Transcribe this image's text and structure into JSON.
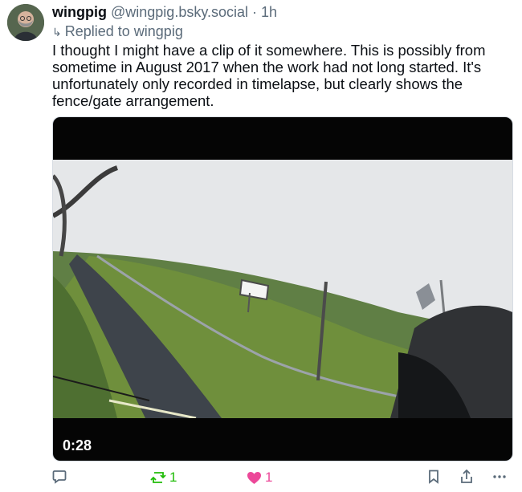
{
  "post": {
    "display_name": "wingpig",
    "handle": "@wingpig.bsky.social",
    "separator": "·",
    "time": "1h",
    "reply_arrow": "↳",
    "replied_to": "Replied to wingpig",
    "text": "I thought I might have a clip of it somewhere. This is possibly from sometime in August 2017 when the work had not long started. It's unfortunately only recorded in timelapse, but clearly shows the fence/gate arrangement."
  },
  "video": {
    "timestamp": "0:28"
  },
  "actions": {
    "reply_icon": "speech-bubble-icon",
    "repost_icon": "repost-icon",
    "repost_count": "1",
    "like_icon": "heart-icon",
    "like_count": "1",
    "bookmark_icon": "bookmark-icon",
    "share_icon": "share-icon",
    "more_icon": "ellipsis-icon"
  },
  "colors": {
    "text": "#0b0f14",
    "muted": "#5b6b7a",
    "repost": "#20bc07",
    "like": "#ec4899"
  }
}
